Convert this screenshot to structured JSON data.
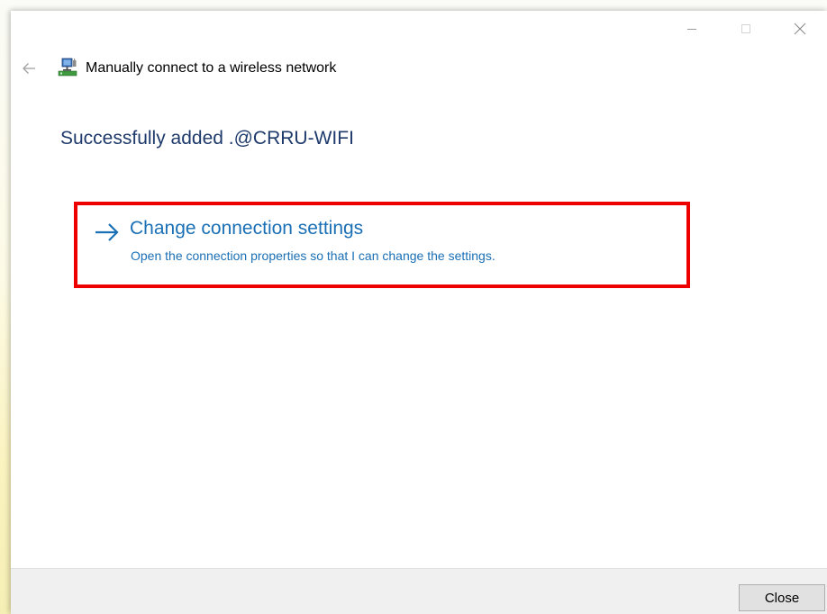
{
  "window": {
    "title_bar_buttons": [
      "minimize-icon",
      "maximize-icon",
      "close-icon"
    ]
  },
  "wizard": {
    "back_icon": "back-arrow-icon",
    "network_icon": "wireless-network-icon",
    "title": "Manually connect to a wireless network"
  },
  "main": {
    "heading": "Successfully added .@CRRU-WIFI",
    "change_link": {
      "icon": "right-arrow-icon",
      "title": "Change connection settings",
      "description": "Open the connection properties so that I can change the settings."
    }
  },
  "footer": {
    "close_label": "Close"
  },
  "colors": {
    "heading": "#1e3a6b",
    "link": "#1a6fb5",
    "highlight": "#ee0000"
  }
}
